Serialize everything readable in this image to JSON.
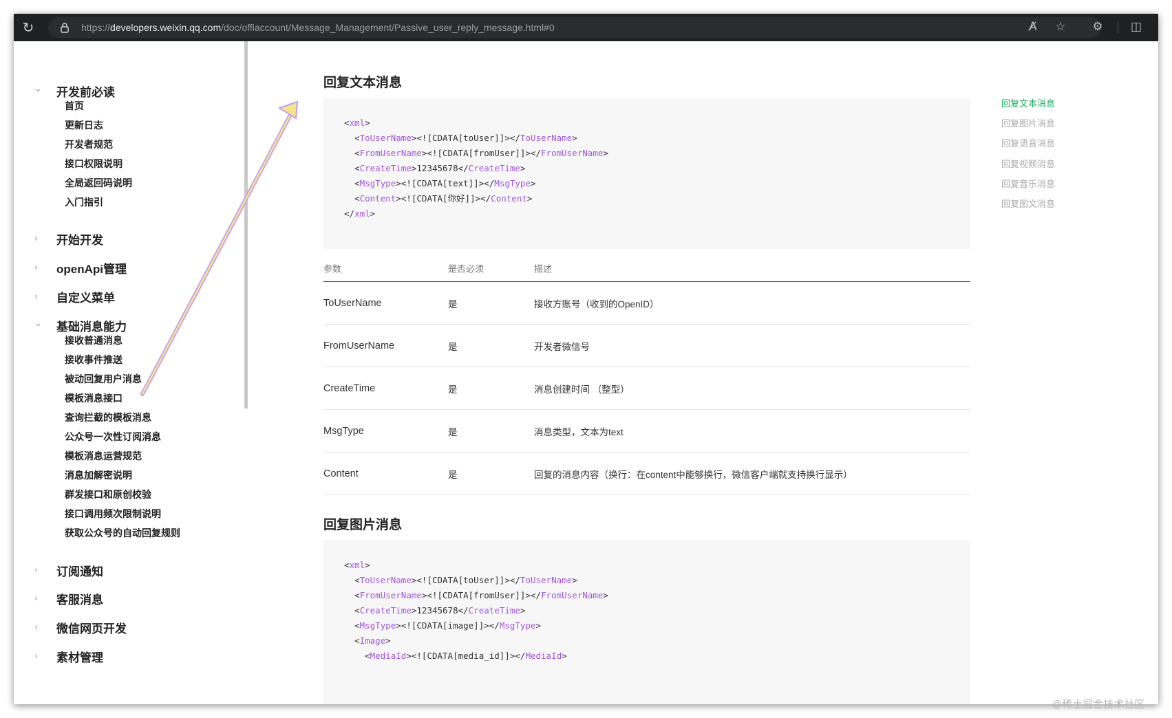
{
  "browser": {
    "url_prefix": "https://",
    "url_host": "developers.weixin.qq.com",
    "url_path": "/doc/offiaccount/Message_Management/Passive_user_reply_message.html#0"
  },
  "sidebar": {
    "sections": [
      {
        "label": "开发前必读",
        "expanded": true
      },
      {
        "label": "开始开发",
        "expanded": false
      },
      {
        "label": "openApi管理",
        "expanded": false
      },
      {
        "label": "自定义菜单",
        "expanded": false
      },
      {
        "label": "基础消息能力",
        "expanded": true
      },
      {
        "label": "订阅通知",
        "expanded": false
      },
      {
        "label": "客服消息",
        "expanded": false
      },
      {
        "label": "微信网页开发",
        "expanded": false
      },
      {
        "label": "素材管理",
        "expanded": false
      }
    ],
    "items_dev": [
      "首页",
      "更新日志",
      "开发者规范",
      "接口权限说明",
      "全局返回码说明",
      "入门指引"
    ],
    "items_basic": [
      "接收普通消息",
      "接收事件推送",
      "被动回复用户消息",
      "模板消息接口",
      "查询拦截的模板消息",
      "公众号一次性订阅消息",
      "模板消息运营规范",
      "消息加解密说明",
      "群发接口和原创校验",
      "接口调用频次限制说明",
      "获取公众号的自动回复规则"
    ]
  },
  "main": {
    "heading_text": "回复文本消息",
    "heading_image": "回复图片消息",
    "code_text": [
      {
        "t": "xml",
        "close": false,
        "indent": 0
      },
      {
        "t": "ToUserName",
        "v": "<![CDATA[toUser]]>",
        "indent": 1
      },
      {
        "t": "FromUserName",
        "v": "<![CDATA[fromUser]]>",
        "indent": 1
      },
      {
        "t": "CreateTime",
        "v": "12345678",
        "indent": 1
      },
      {
        "t": "MsgType",
        "v": "<![CDATA[text]]>",
        "indent": 1
      },
      {
        "t": "Content",
        "v": "<![CDATA[你好]]>",
        "indent": 1
      },
      {
        "t": "xml",
        "close": true,
        "indent": 0
      }
    ],
    "code_image": [
      {
        "t": "xml",
        "close": false,
        "indent": 0
      },
      {
        "t": "ToUserName",
        "v": "<![CDATA[toUser]]>",
        "indent": 1
      },
      {
        "t": "FromUserName",
        "v": "<![CDATA[fromUser]]>",
        "indent": 1
      },
      {
        "t": "CreateTime",
        "v": "12345678",
        "indent": 1
      },
      {
        "t": "MsgType",
        "v": "<![CDATA[image]]>",
        "indent": 1
      },
      {
        "t": "Image",
        "close": false,
        "indent": 1
      },
      {
        "t": "MediaId",
        "v": "<![CDATA[media_id]]>",
        "indent": 2
      }
    ],
    "table": {
      "headers": [
        "参数",
        "是否必须",
        "描述"
      ],
      "rows": [
        [
          "ToUserName",
          "是",
          "接收方账号（收到的OpenID）"
        ],
        [
          "FromUserName",
          "是",
          "开发者微信号"
        ],
        [
          "CreateTime",
          "是",
          "消息创建时间 （整型）"
        ],
        [
          "MsgType",
          "是",
          "消息类型，文本为text"
        ],
        [
          "Content",
          "是",
          "回复的消息内容（换行：在content中能够换行，微信客户端就支持换行显示）"
        ]
      ]
    }
  },
  "toc": {
    "items": [
      "回复文本消息",
      "回复图片消息",
      "回复语音消息",
      "回复视频消息",
      "回复音乐消息",
      "回复图文消息"
    ],
    "active_index": 0,
    "active_color": "#1aad5f"
  },
  "annotation": {
    "arrow_color": "#f5e58a",
    "arrow_glow": "#c79cf0"
  },
  "watermark": "@稀土掘金技术社区"
}
